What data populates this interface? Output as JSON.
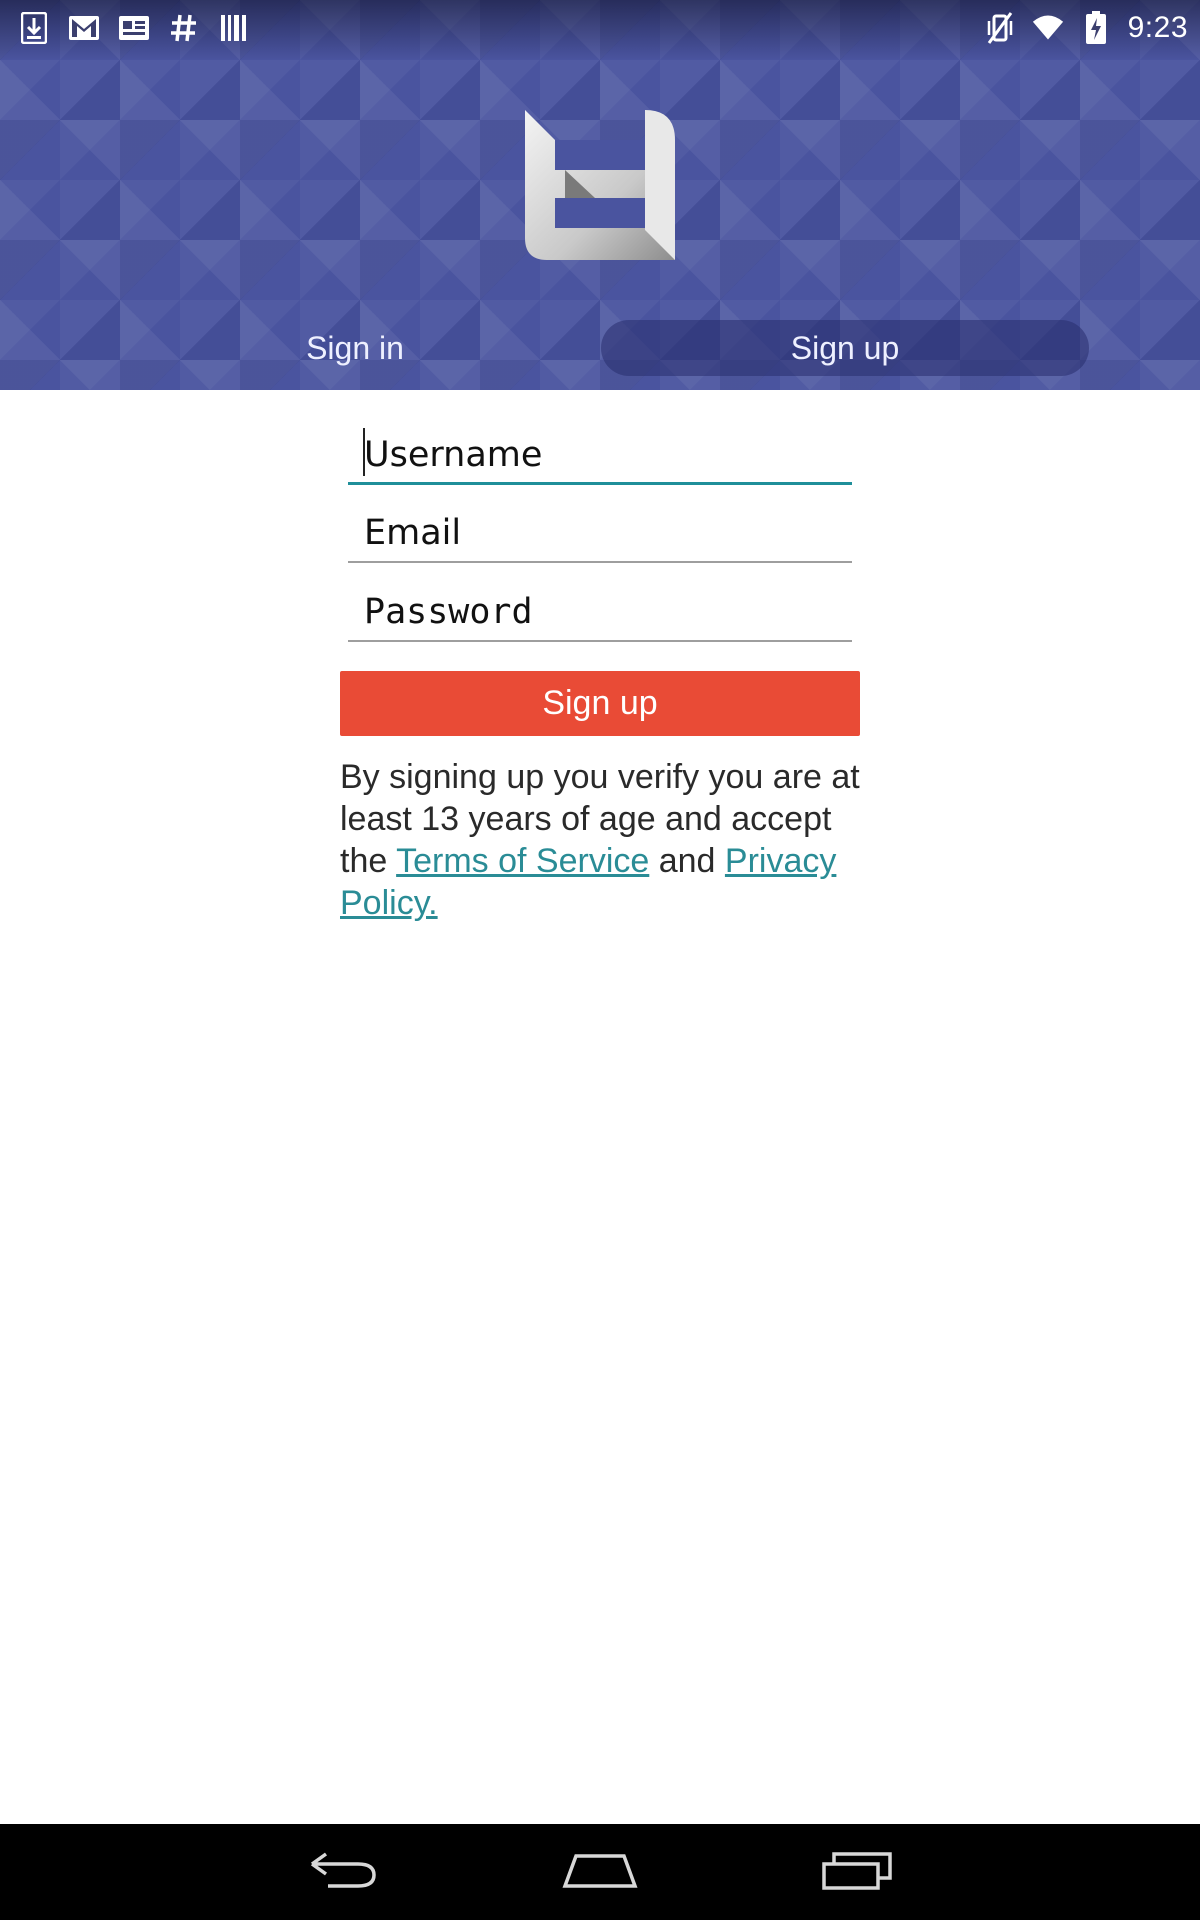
{
  "status_bar": {
    "time": "9:23",
    "left_icons": [
      "download-icon",
      "gmail-icon",
      "news-icon",
      "hashtag-icon",
      "barcode-icon"
    ],
    "right_icons": [
      "vibrate-mute-icon",
      "wifi-icon",
      "battery-charging-icon"
    ]
  },
  "header": {
    "logo": "app-logo",
    "background_color": "#4a549f",
    "tabs": [
      {
        "label": "Sign in",
        "selected": false
      },
      {
        "label": "Sign up",
        "selected": true
      }
    ]
  },
  "form": {
    "username": {
      "placeholder": "Username",
      "value": ""
    },
    "email": {
      "placeholder": "Email",
      "value": ""
    },
    "password": {
      "placeholder": "Password",
      "value": ""
    },
    "submit_label": "Sign up",
    "submit_color": "#e94b36",
    "accent_color": "#1f8f9a"
  },
  "terms": {
    "prefix": "By signing up you verify you are at least 13 years of age and accept the ",
    "terms_link": "Terms of Service",
    "middle": " and ",
    "privacy_link": "Privacy Policy."
  },
  "nav_bar": {
    "icons": [
      "back-icon",
      "home-icon",
      "recents-icon"
    ]
  }
}
